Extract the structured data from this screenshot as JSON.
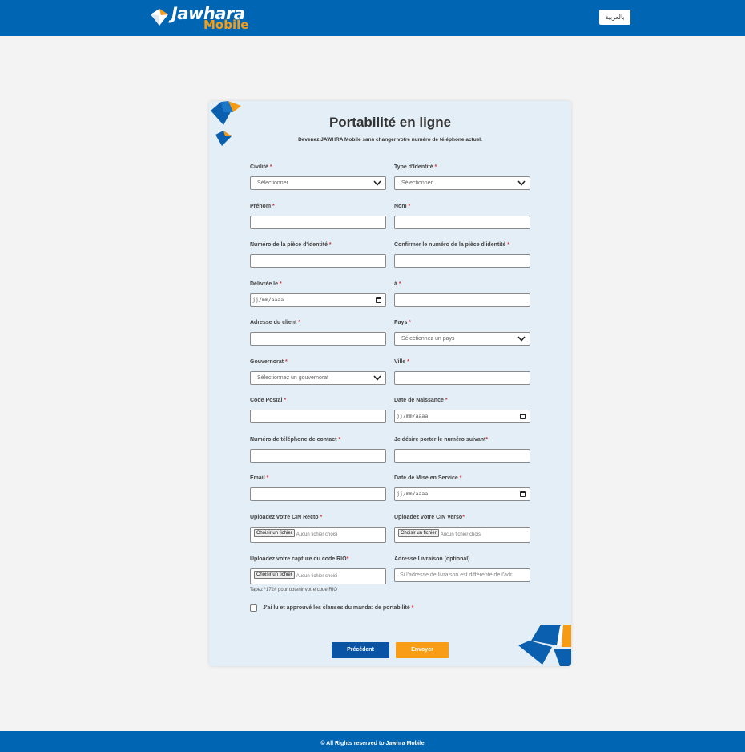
{
  "header": {
    "brand": "Jawhara",
    "brand_sub": "Mobile",
    "lang_button": "بالعربية",
    "colors": {
      "primary": "#0065b3",
      "accent": "#f59b14"
    }
  },
  "form": {
    "title": "Portabilité en ligne",
    "subtitle": "Devenez JAWHRA Mobile sans changer votre numéro de téléphone actuel.",
    "required_mark": "*",
    "fields": {
      "civilite": {
        "label": "Civilité ",
        "value": "Sélectionner"
      },
      "type_identite": {
        "label": "Type d'Identité ",
        "value": "Sélectionner"
      },
      "prenom": {
        "label": "Prénom ",
        "value": ""
      },
      "nom": {
        "label": "Nom ",
        "value": ""
      },
      "numero_piece": {
        "label": "Numéro de la pièce d'identité ",
        "value": ""
      },
      "confirmer_numero": {
        "label": "Confirmer le numéro de la pièce d'identité ",
        "value": ""
      },
      "delivree_le": {
        "label": "Délivrée le ",
        "value": "jj/mm/aaaa"
      },
      "a": {
        "label": "à ",
        "value": ""
      },
      "adresse": {
        "label": "Adresse du client ",
        "value": ""
      },
      "pays": {
        "label": "Pays ",
        "value": "Sélectionnez un pays"
      },
      "gouvernorat": {
        "label": "Gouvernorat ",
        "value": "Sélectionnez un gouvernorat"
      },
      "ville": {
        "label": "Ville ",
        "value": ""
      },
      "code_postal": {
        "label": "Code Postal ",
        "value": ""
      },
      "date_naissance": {
        "label": "Date de Naissance ",
        "value": "jj/mm/aaaa"
      },
      "tel_contact": {
        "label": "Numéro de téléphone de contact ",
        "value": ""
      },
      "numero_porter": {
        "label": "Je désire porter le numéro suivant",
        "value": ""
      },
      "email": {
        "label": "Email ",
        "value": ""
      },
      "date_mise_service": {
        "label": "Date de Mise en Service ",
        "value": "jj/mm/aaaa"
      },
      "cin_recto": {
        "label": "Uploadez votre CIN Recto ",
        "button": "Choisir un fichier",
        "status": "Aucun fichier choisi"
      },
      "cin_verso": {
        "label": "Uploadez votre CIN Verso",
        "button": "Choisir un fichier",
        "status": "Aucun fichier choisi"
      },
      "code_rio": {
        "label": "Uploadez votre capture du code RIO",
        "button": "Choisir un fichier",
        "status": "Aucun fichier choisi",
        "hint": "Tapez *172# pour obtenir votre code RIO"
      },
      "adresse_livraison": {
        "label": "Adresse Livraison (optional)",
        "placeholder": "Si l'adresse de livraison est différente de l'adr"
      }
    },
    "consent": {
      "label": "J'ai lu et approuvé les clauses du mandat de portabilité ",
      "checked": false
    },
    "buttons": {
      "previous": "Précédent",
      "submit": "Envoyer"
    }
  },
  "footer": {
    "text": "© All Rights reserved to Jawhra Mobile"
  }
}
